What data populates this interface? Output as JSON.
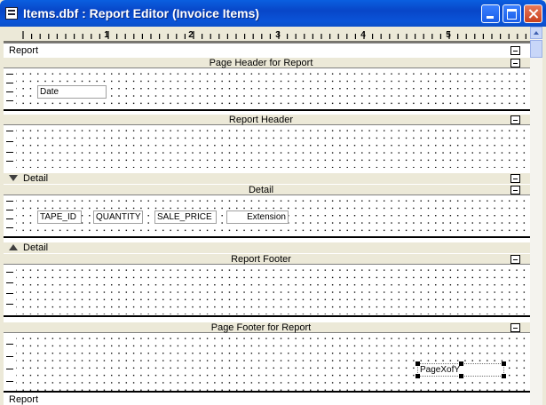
{
  "window": {
    "title": "Items.dbf : Report Editor (Invoice Items)"
  },
  "ruler": {
    "labels": [
      "1",
      "2",
      "3",
      "4",
      "5"
    ]
  },
  "report_label_top": "Report",
  "report_label_bottom": "Report",
  "bands": {
    "page_header": "Page Header for Report",
    "report_header": "Report Header",
    "detail": "Detail",
    "report_footer": "Report Footer",
    "page_footer": "Page Footer for Report"
  },
  "groups": {
    "detail_open": "Detail",
    "detail_close": "Detail"
  },
  "fields": {
    "date": "Date",
    "tape_id": "TAPE_ID",
    "quantity": "QUANTITY",
    "sale_price": "SALE_PRICE",
    "extension": "Extension",
    "page_x_of_y": "PageXofY"
  }
}
